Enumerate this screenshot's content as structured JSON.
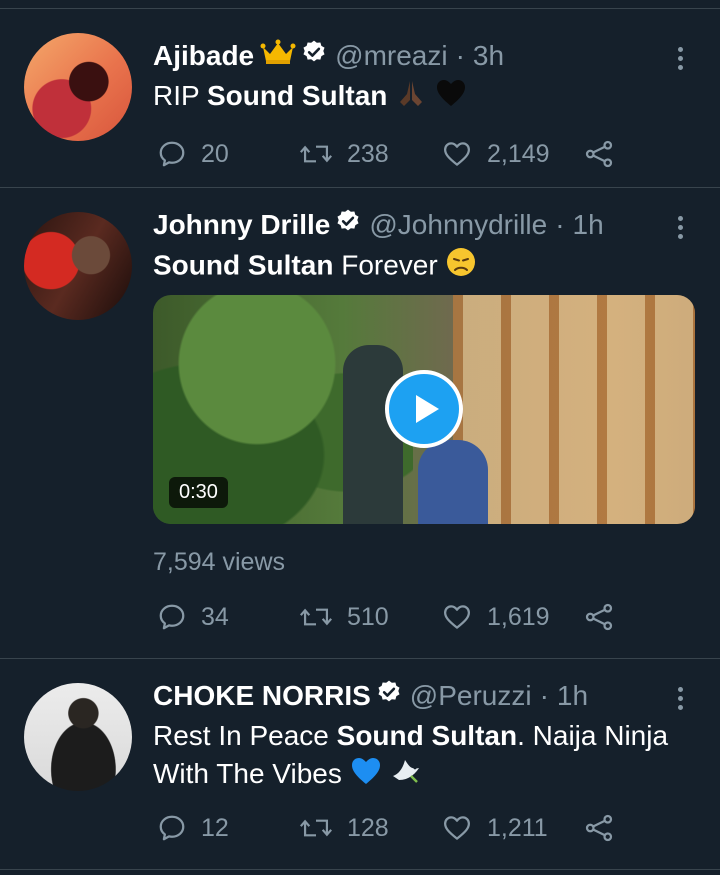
{
  "tweets": [
    {
      "name": "Ajibade",
      "handle": "@mreazi",
      "separator": "·",
      "time": "3h",
      "text_prefix": "RIP ",
      "text_bold": "Sound Sultan",
      "text_suffix": "",
      "replies": "20",
      "retweets": "238",
      "likes": "2,149"
    },
    {
      "name": "Johnny Drille",
      "handle": "@Johnnydrille",
      "separator": "·",
      "time": "1h",
      "text_bold": "Sound Sultan",
      "text_suffix": " Forever",
      "video_duration": "0:30",
      "views": "7,594 views",
      "replies": "34",
      "retweets": "510",
      "likes": "1,619"
    },
    {
      "name": "CHOKE NORRIS",
      "handle": "@Peruzzi",
      "separator": "·",
      "time": "1h",
      "text_prefix": "Rest In Peace ",
      "text_bold": "Sound Sultan",
      "text_suffix": ". Naija Ninja With The Vibes",
      "replies": "12",
      "retweets": "128",
      "likes": "1,211"
    }
  ],
  "colors": {
    "background": "#15202b",
    "secondary_text": "#8899a6",
    "accent": "#1da1f2",
    "divider": "#38444d"
  }
}
